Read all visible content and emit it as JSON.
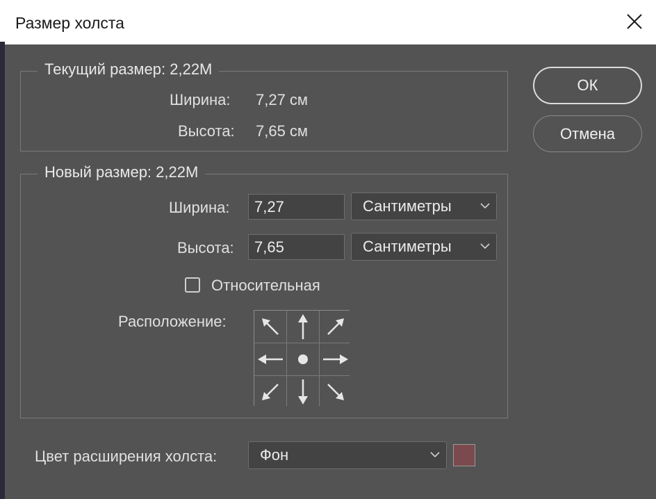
{
  "window": {
    "title": "Размер холста"
  },
  "current": {
    "legend": "Текущий размер: 2,22M",
    "width_label": "Ширина:",
    "width_value": "7,27 см",
    "height_label": "Высота:",
    "height_value": "7,65 см"
  },
  "new_size": {
    "legend": "Новый размер: 2,22M",
    "width_label": "Ширина:",
    "width_value": "7,27",
    "width_unit": "Сантиметры",
    "height_label": "Высота:",
    "height_value": "7,65",
    "height_unit": "Сантиметры",
    "relative_label": "Относительная",
    "relative_checked": false,
    "anchor_label": "Расположение:"
  },
  "buttons": {
    "ok": "ОК",
    "cancel": "Отмена"
  },
  "extension": {
    "label": "Цвет расширения холста:",
    "value": "Фон",
    "swatch_color": "#7a4a4e"
  },
  "colors": {
    "dialog_bg": "#535353",
    "titlebar_bg": "#ffffff",
    "text": "#e0e0e0"
  }
}
